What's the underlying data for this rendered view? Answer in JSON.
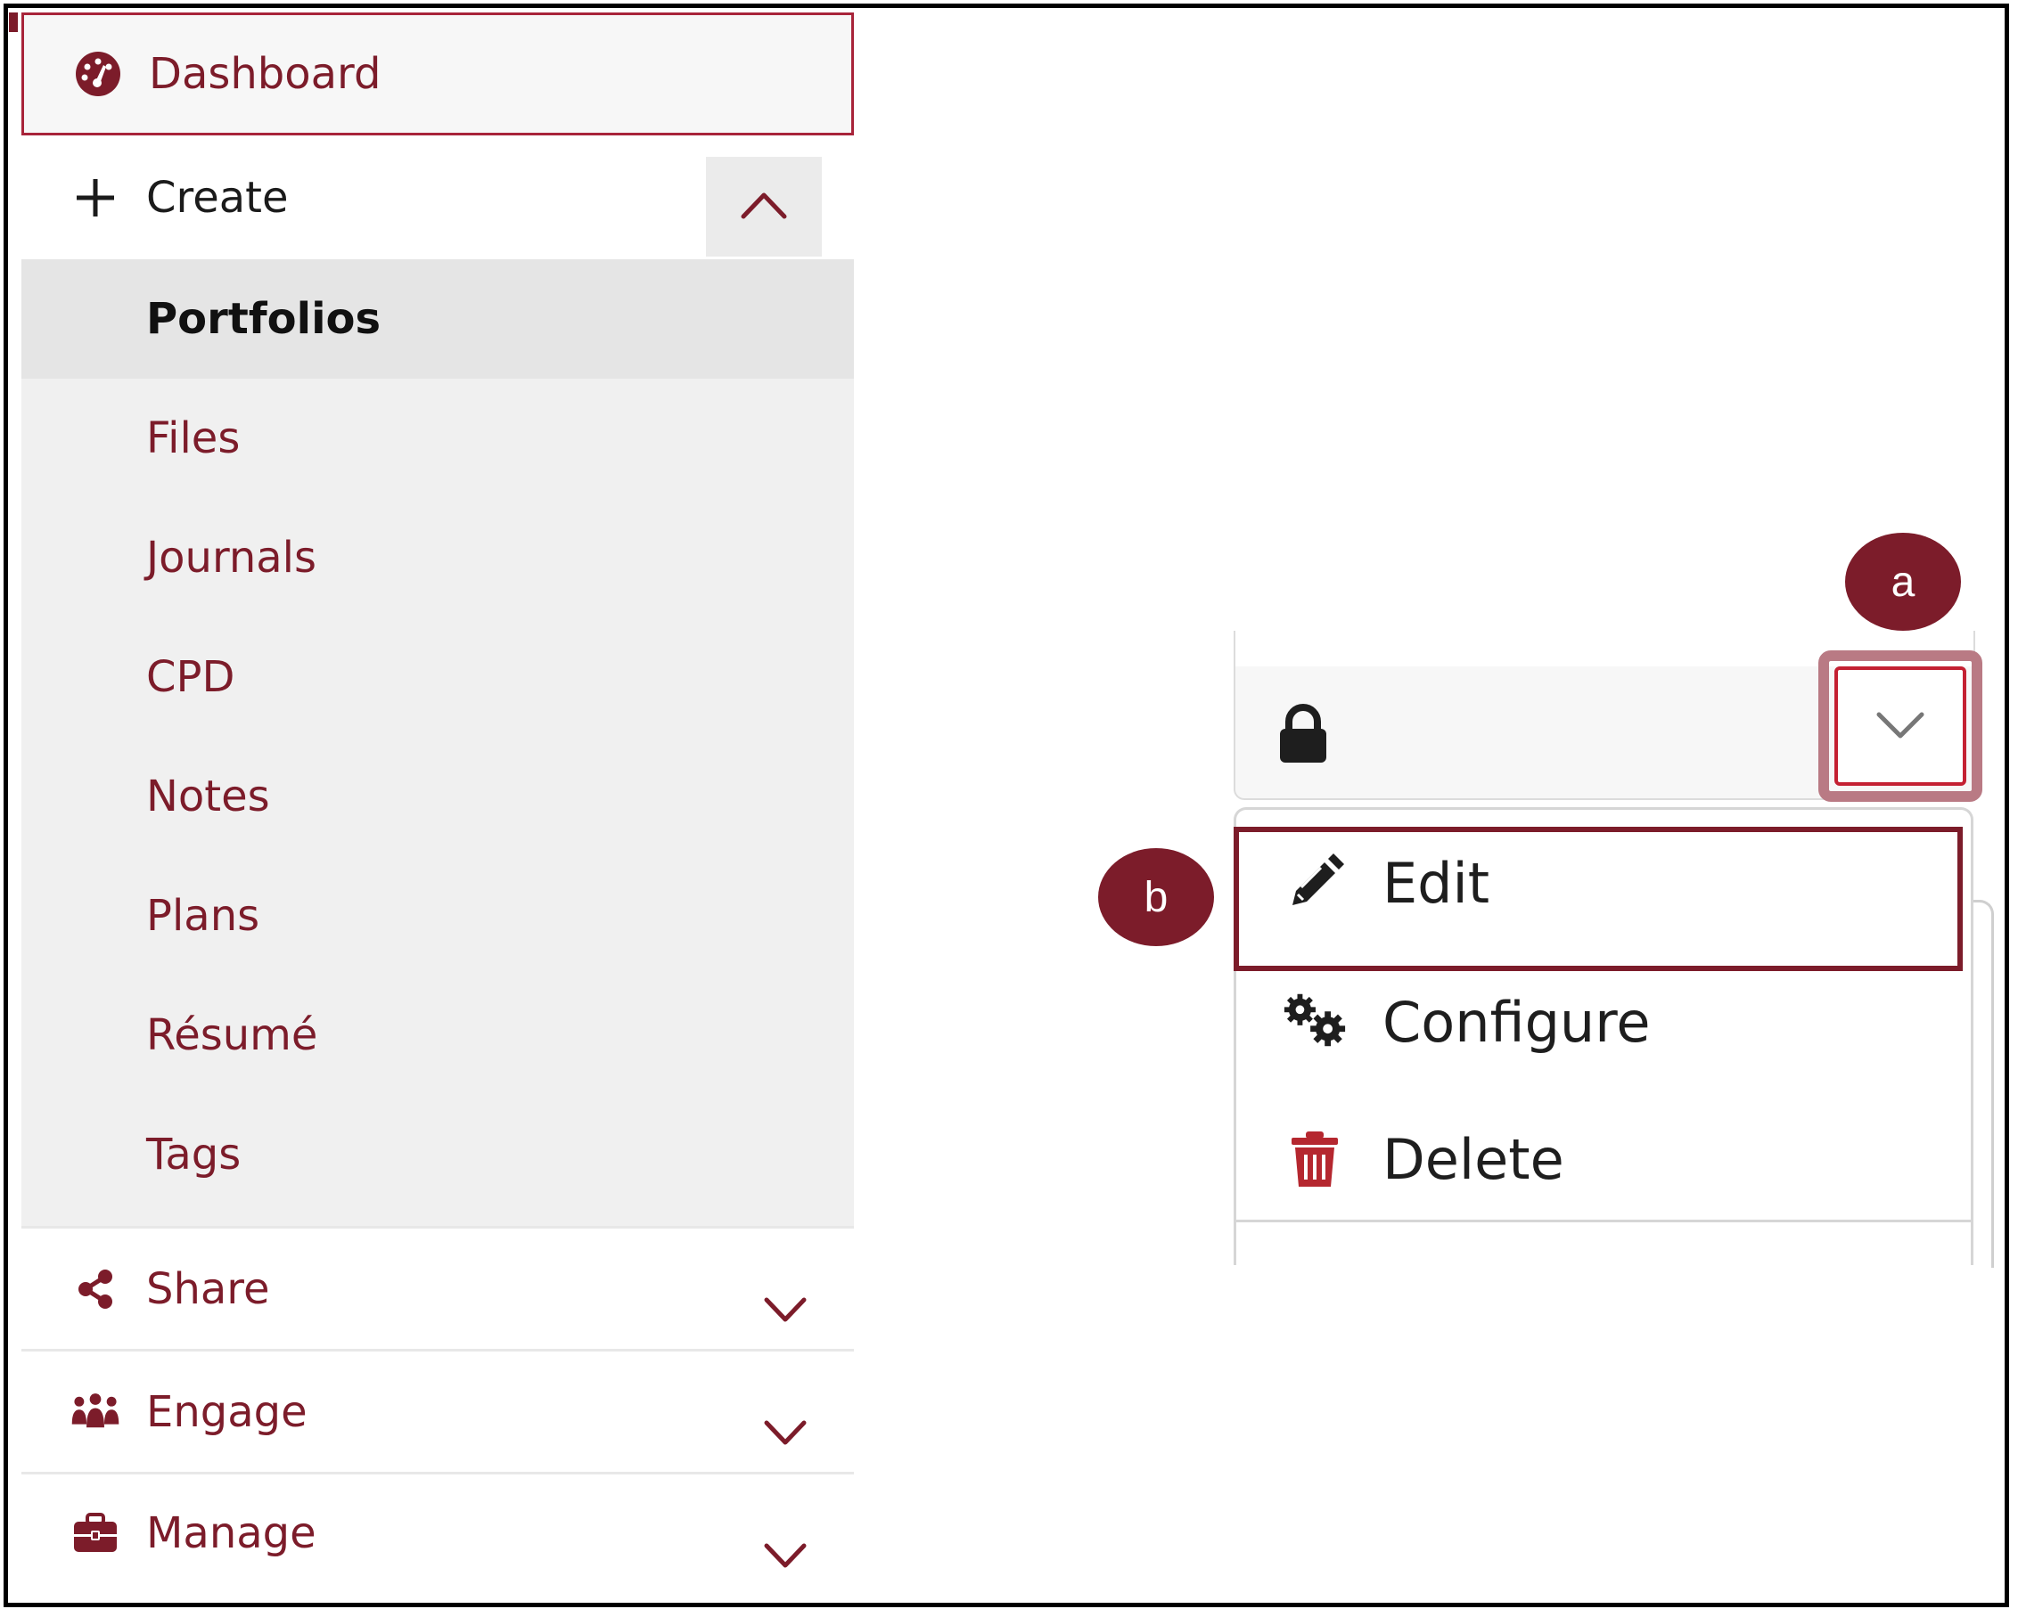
{
  "sidebar": {
    "dashboard": "Dashboard",
    "create": "Create",
    "create_items": [
      "Portfolios",
      "Files",
      "Journals",
      "CPD",
      "Notes",
      "Plans",
      "Résumé",
      "Tags"
    ],
    "active_item": "Portfolios",
    "sections": {
      "share": "Share",
      "engage": "Engage",
      "manage": "Manage"
    }
  },
  "menu": {
    "edit": "Edit",
    "configure": "Configure",
    "delete": "Delete"
  },
  "callouts": {
    "a": "a",
    "b": "b"
  },
  "colors": {
    "accent": "#7c1c2a",
    "highlight": "#c42032",
    "submenu_bg": "#f0f0f0"
  },
  "icons": {
    "dashboard": "dashboard-icon",
    "create": "plus-icon",
    "share": "share-icon",
    "engage": "users-icon",
    "manage": "briefcase-icon",
    "lock": "lock-icon",
    "edit": "pencil-icon",
    "configure": "gears-icon",
    "delete": "trash-icon"
  }
}
